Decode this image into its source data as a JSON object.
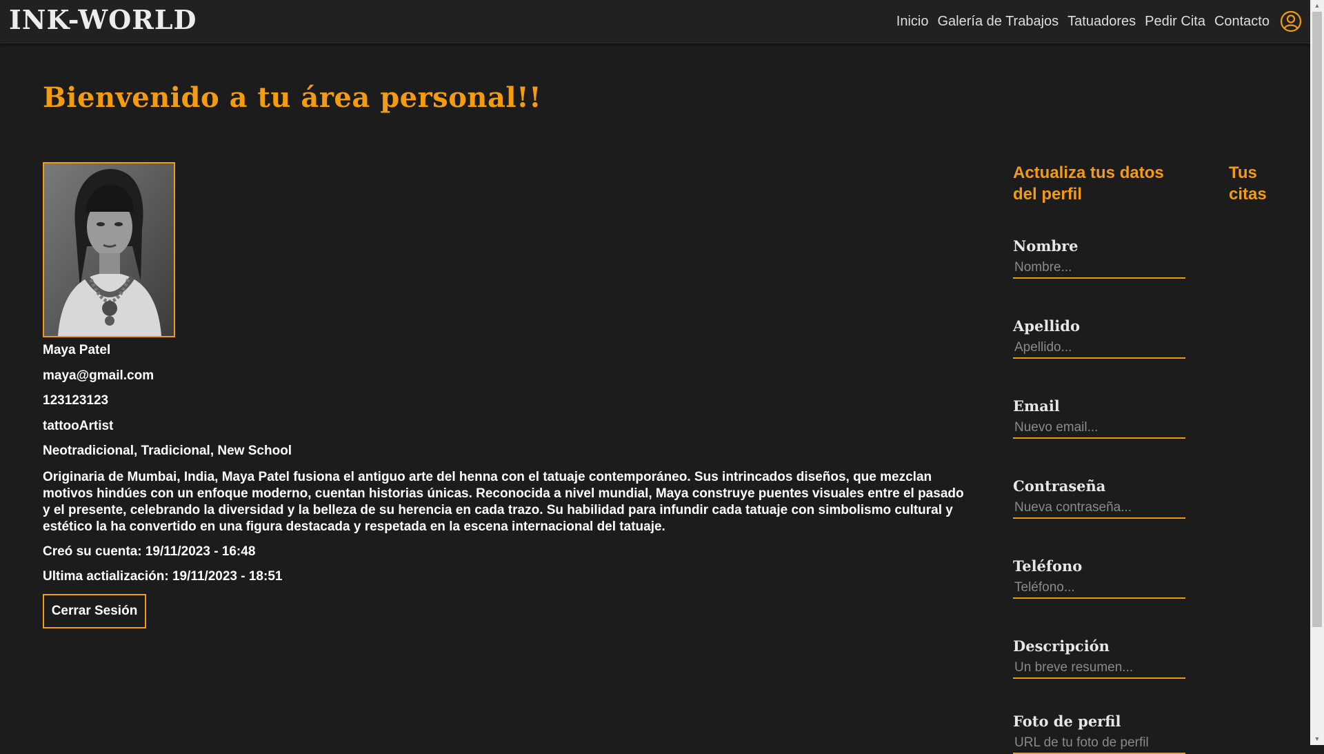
{
  "header": {
    "logo": "INK-WORLD",
    "nav": [
      "Inicio",
      "Galería de Trabajos",
      "Tatuadores",
      "Pedir Cita",
      "Contacto"
    ],
    "user_icon": "user-circle-icon"
  },
  "main": {
    "title": "Bienvenido a tu área personal!!",
    "profile": {
      "name": "Maya Patel",
      "email": "maya@gmail.com",
      "phone": "123123123",
      "role": "tattooArtist",
      "styles": "Neotradicional, Tradicional, New School",
      "bio": "Originaria de Mumbai, India, Maya Patel fusiona el antiguo arte del henna con el tatuaje contemporáneo. Sus intrincados diseños, que mezclan motivos hindúes con un enfoque moderno, cuentan historias únicas. Reconocida a nivel mundial, Maya construye puentes visuales entre el pasado y el presente, celebrando la diversidad y la belleza de su herencia en cada trazo. Su habilidad para infundir cada tatuaje con simbolismo cultural y estético la ha convertido en una figura destacada y respetada en la escena internacional del tatuaje.",
      "created": "Creó su cuenta: 19/11/2023 - 16:48",
      "updated": "Ultima actialización: 19/11/2023 - 18:51"
    },
    "logout_label": "Cerrar Sesión"
  },
  "update_form": {
    "title": "Actualiza tus datos del perfil",
    "fields": [
      {
        "label": "Nombre",
        "placeholder": "Nombre..."
      },
      {
        "label": "Apellido",
        "placeholder": "Apellido..."
      },
      {
        "label": "Email",
        "placeholder": "Nuevo email..."
      },
      {
        "label": "Contraseña",
        "placeholder": "Nueva contraseña..."
      },
      {
        "label": "Teléfono",
        "placeholder": "Teléfono..."
      },
      {
        "label": "Descripción",
        "placeholder": "Un breve resumen..."
      },
      {
        "label": "Foto de perfil",
        "placeholder": "URL de tu foto de perfil"
      }
    ]
  },
  "appointments": {
    "title": "Tus citas"
  },
  "colors": {
    "accent": "#f39c12",
    "background": "#1c1c1c",
    "header": "#212121"
  }
}
